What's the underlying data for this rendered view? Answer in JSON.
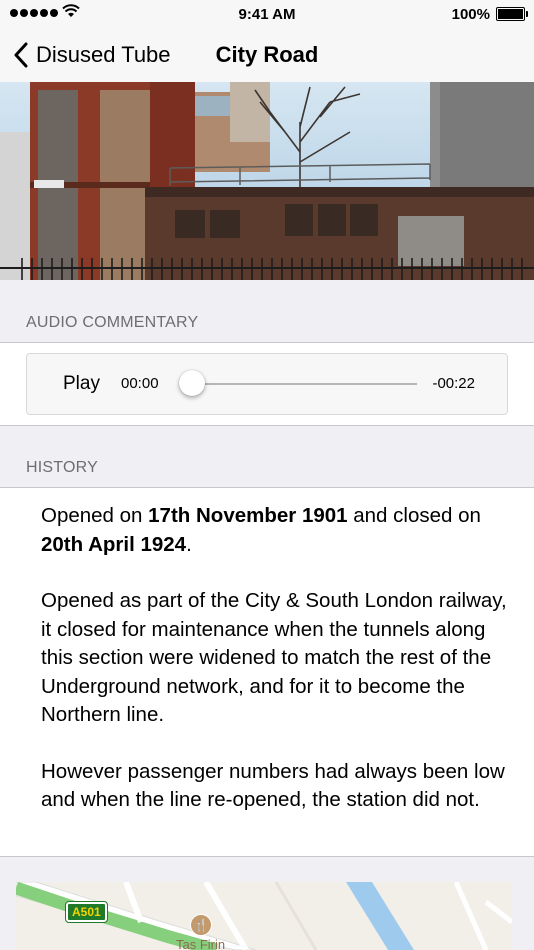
{
  "status_bar": {
    "time": "9:41 AM",
    "battery": "100%"
  },
  "nav": {
    "back_label": "Disused Tube",
    "title": "City Road"
  },
  "audio": {
    "header": "AUDIO COMMENTARY",
    "play_label": "Play",
    "elapsed": "00:00",
    "remaining": "-00:22",
    "progress": 0.0
  },
  "history": {
    "header": "HISTORY",
    "p1_pre": "Opened on ",
    "p1_date1": "17th November 1901",
    "p1_mid": " and closed on ",
    "p1_date2": "20th April 1924",
    "p1_post": ".",
    "p2": "Opened as part of the City & South London railway, it closed for maintenance when the tunnels along this section were widened to match the rest of the Underground network, and for it to become the Northern line.",
    "p3": "However passenger numbers had always been low and when the line re-opened, the station did not."
  },
  "map": {
    "road_label": "A501",
    "poi_label": "Tas Firin",
    "poi_icon": "restaurant-icon"
  }
}
